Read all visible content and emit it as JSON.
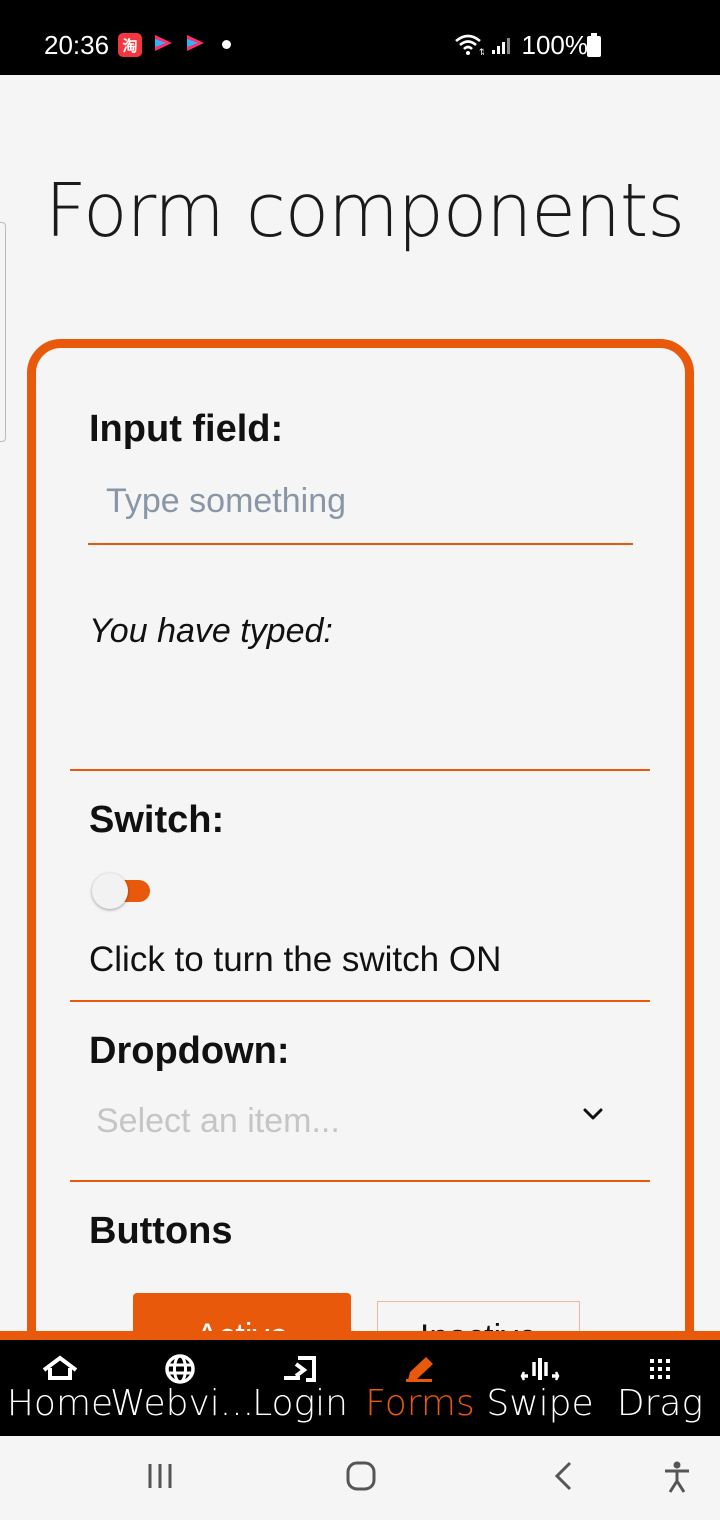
{
  "status_bar": {
    "time": "20:36",
    "battery": "100%",
    "icons": [
      "taobao-app-icon",
      "youku-app-icon",
      "youku-app-icon",
      "notification-dot",
      "wifi-icon",
      "signal-icon",
      "battery-icon"
    ]
  },
  "page": {
    "title": "Form components"
  },
  "form": {
    "input_section_label": "Input field:",
    "input_placeholder": "Type something",
    "typed_label": "You have typed:",
    "switch_section_label": "Switch:",
    "switch_state": "off",
    "switch_text": "Click to turn the switch ON",
    "dropdown_section_label": "Dropdown:",
    "dropdown_placeholder": "Select an item...",
    "buttons_section_label": "Buttons",
    "active_button_label": "Active",
    "inactive_button_label": "Inactive"
  },
  "tabs": [
    {
      "label": "Home",
      "icon": "home-icon",
      "active": false
    },
    {
      "label": "Webvi...",
      "icon": "globe-icon",
      "active": false
    },
    {
      "label": "Login",
      "icon": "login-icon",
      "active": false
    },
    {
      "label": "Forms",
      "icon": "pencil-icon",
      "active": true
    },
    {
      "label": "Swipe",
      "icon": "swipe-icon",
      "active": false
    },
    {
      "label": "Drag",
      "icon": "grid-icon",
      "active": false
    }
  ],
  "colors": {
    "accent": "#e8590c",
    "background": "#f5f5f5",
    "tab_bar": "#000000"
  }
}
